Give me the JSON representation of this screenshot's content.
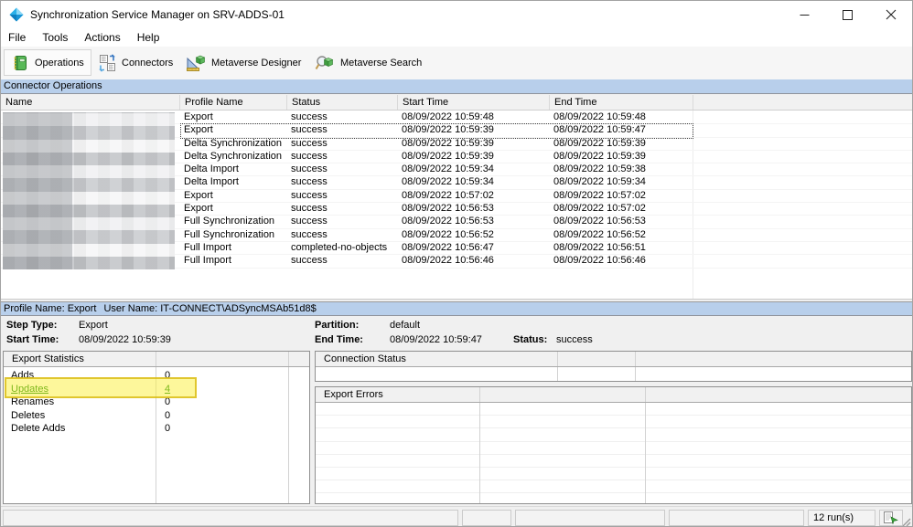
{
  "window": {
    "title": "Synchronization Service Manager on SRV-ADDS-01",
    "icon": "sync-diamond-icon"
  },
  "menu": {
    "items": [
      {
        "label": "File"
      },
      {
        "label": "Tools"
      },
      {
        "label": "Actions"
      },
      {
        "label": "Help"
      }
    ]
  },
  "toolbar": {
    "buttons": [
      {
        "label": "Operations",
        "icon": "operations-book-icon",
        "active": true
      },
      {
        "label": "Connectors",
        "icon": "connectors-icon",
        "active": false
      },
      {
        "label": "Metaverse Designer",
        "icon": "metaverse-designer-icon",
        "active": false
      },
      {
        "label": "Metaverse Search",
        "icon": "metaverse-search-icon",
        "active": false
      }
    ]
  },
  "operations_view": {
    "title": "Connector Operations",
    "columns": [
      "Name",
      "Profile Name",
      "Status",
      "Start Time",
      "End Time"
    ],
    "name_column_redacted": true,
    "rows": [
      {
        "name": "",
        "profile": "Export",
        "status": "success",
        "start": "08/09/2022 10:59:48",
        "end": "08/09/2022 10:59:48",
        "selected": false
      },
      {
        "name": "",
        "profile": "Export",
        "status": "success",
        "start": "08/09/2022 10:59:39",
        "end": "08/09/2022 10:59:47",
        "selected": true
      },
      {
        "name": "",
        "profile": "Delta Synchronization",
        "status": "success",
        "start": "08/09/2022 10:59:39",
        "end": "08/09/2022 10:59:39",
        "selected": false
      },
      {
        "name": "",
        "profile": "Delta Synchronization",
        "status": "success",
        "start": "08/09/2022 10:59:39",
        "end": "08/09/2022 10:59:39",
        "selected": false
      },
      {
        "name": "",
        "profile": "Delta Import",
        "status": "success",
        "start": "08/09/2022 10:59:34",
        "end": "08/09/2022 10:59:38",
        "selected": false
      },
      {
        "name": "",
        "profile": "Delta Import",
        "status": "success",
        "start": "08/09/2022 10:59:34",
        "end": "08/09/2022 10:59:34",
        "selected": false
      },
      {
        "name": "",
        "profile": "Export",
        "status": "success",
        "start": "08/09/2022 10:57:02",
        "end": "08/09/2022 10:57:02",
        "selected": false
      },
      {
        "name": "",
        "profile": "Export",
        "status": "success",
        "start": "08/09/2022 10:56:53",
        "end": "08/09/2022 10:57:02",
        "selected": false
      },
      {
        "name": "",
        "profile": "Full Synchronization",
        "status": "success",
        "start": "08/09/2022 10:56:53",
        "end": "08/09/2022 10:56:53",
        "selected": false
      },
      {
        "name": "",
        "profile": "Full Synchronization",
        "status": "success",
        "start": "08/09/2022 10:56:52",
        "end": "08/09/2022 10:56:52",
        "selected": false
      },
      {
        "name": "",
        "profile": "Full Import",
        "status": "completed-no-objects",
        "start": "08/09/2022 10:56:47",
        "end": "08/09/2022 10:56:51",
        "selected": false
      },
      {
        "name": "",
        "profile": "Full Import",
        "status": "success",
        "start": "08/09/2022 10:56:46",
        "end": "08/09/2022 10:56:46",
        "selected": false
      }
    ]
  },
  "run_details": {
    "profile_name_label": "Profile Name: Export",
    "user_name_label": "User Name: IT-CONNECT\\ADSyncMSAb51d8$",
    "fields": {
      "step_type_label": "Step Type:",
      "step_type": "Export",
      "start_time_label": "Start Time:",
      "start_time": "08/09/2022 10:59:39",
      "partition_label": "Partition:",
      "partition": "default",
      "end_time_label": "End Time:",
      "end_time": "08/09/2022 10:59:47",
      "status_label": "Status:",
      "status": "success"
    }
  },
  "export_statistics": {
    "title": "Export Statistics",
    "rows": [
      {
        "label": "Adds",
        "value": "0",
        "link": false,
        "highlighted": false
      },
      {
        "label": "Updates",
        "value": "4",
        "link": true,
        "highlighted": true
      },
      {
        "label": "Renames",
        "value": "0",
        "link": false,
        "highlighted": false
      },
      {
        "label": "Deletes",
        "value": "0",
        "link": false,
        "highlighted": false
      },
      {
        "label": "Delete Adds",
        "value": "0",
        "link": false,
        "highlighted": false
      }
    ]
  },
  "connection_status": {
    "title": "Connection Status"
  },
  "export_errors": {
    "title": "Export Errors"
  },
  "status_bar": {
    "run_count": "12 run(s)",
    "icon": "operations-log-icon"
  },
  "colors": {
    "section_bar_blue": "#b8cfeb",
    "link_green": "#008000",
    "annotation_highlight_yellow": "#fbf037"
  }
}
